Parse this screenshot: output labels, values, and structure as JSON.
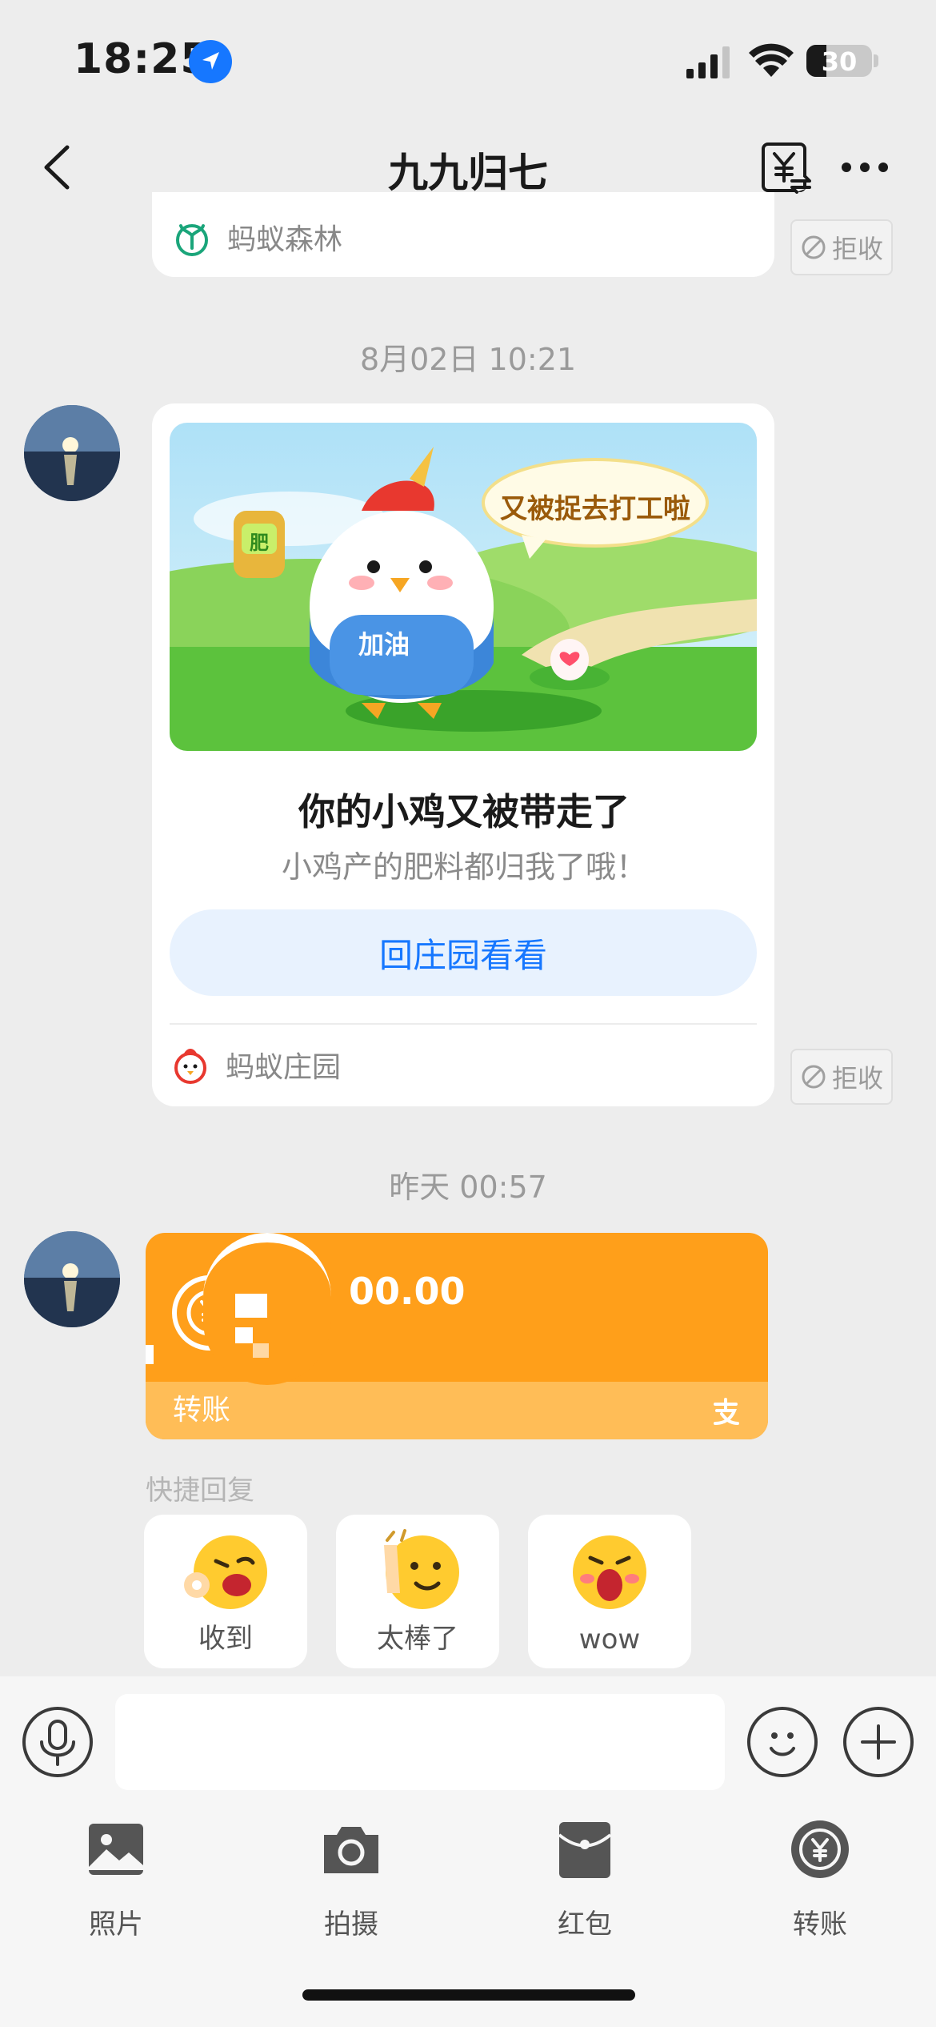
{
  "status_bar": {
    "time": "18:25",
    "battery": "30"
  },
  "header": {
    "title": "九九归七"
  },
  "messages": {
    "forest_card": {
      "source": "蚂蚁森林",
      "reject": "拒收"
    },
    "time1": "8月02日 10:21",
    "farm_card": {
      "image_bag_text": "肥",
      "image_chest_text": "加油",
      "image_bubble": "又被捉去打工啦",
      "title": "你的小鸡又被带走了",
      "subtitle": "小鸡产的肥料都归我了哦！",
      "button": "回庄园看看",
      "source": "蚂蚁庄园",
      "reject": "拒收"
    },
    "time2": "昨天 00:57",
    "transfer": {
      "amount": "00.00",
      "label": "转账",
      "progress_hidden_fraction": 0.5
    }
  },
  "quick_reply": {
    "label": "快捷回复",
    "items": [
      {
        "label": "收到",
        "icon": "wink-ok-emoji-icon"
      },
      {
        "label": "太棒了",
        "icon": "thumbs-up-emoji-icon"
      },
      {
        "label": "wow",
        "icon": "wow-emoji-icon"
      }
    ]
  },
  "input": {
    "placeholder": ""
  },
  "toolbar": {
    "items": [
      {
        "label": "照片",
        "icon": "photo-icon"
      },
      {
        "label": "拍摄",
        "icon": "camera-icon"
      },
      {
        "label": "红包",
        "icon": "red-packet-icon"
      },
      {
        "label": "转账",
        "icon": "transfer-icon"
      }
    ]
  },
  "colors": {
    "accent": "#1677ff",
    "transfer_orange": "#ff9f1a",
    "background": "#ededed"
  }
}
